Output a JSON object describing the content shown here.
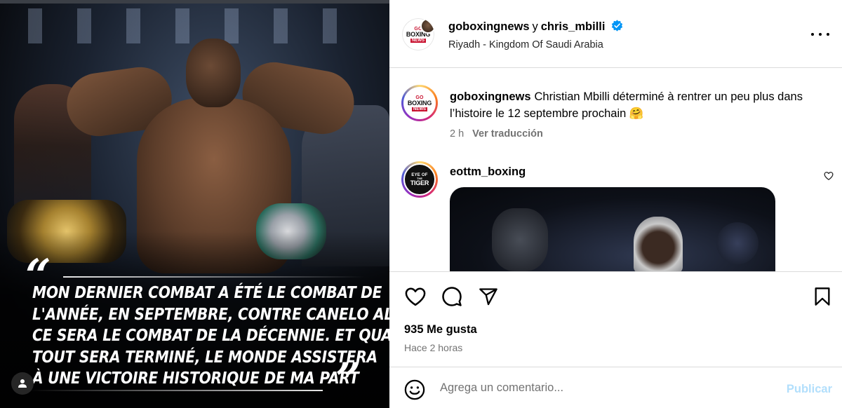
{
  "post_image": {
    "quote_open_mark": "“",
    "quote_close_mark": "”",
    "quote_lines": [
      "Mon dernier combat a été le combat de",
      "l'année, en septembre, contre Canelo Alvarez,",
      "ce sera le combat de la décennie. Et quand",
      "tout sera terminé, le monde assistera",
      "à une victoire historique de ma part"
    ],
    "tag_people_icon": "user-icon"
  },
  "header": {
    "user1": "goboxingnews",
    "separator": "y",
    "user2": "chris_mbilli",
    "verified_icon": "verified-badge-icon",
    "location": "Riyadh - Kingdom Of Saudi Arabia",
    "more_icon": "more-dots-icon",
    "logo": {
      "line1": "GO",
      "line2": "BOXING",
      "line3": "NEWS"
    }
  },
  "caption": {
    "username": "goboxingnews",
    "text": "Christian Mbilli déterminé à rentrer un peu plus dans l’histoire le 12 septembre prochain 🤗",
    "time": "2 h",
    "translate": "Ver traducción"
  },
  "comment": {
    "username": "eottm_boxing",
    "logo": {
      "line1": "EYE OF",
      "line2": "THE",
      "line3": "TIGER"
    },
    "like_icon": "heart-outline-icon"
  },
  "actions": {
    "like_icon": "heart-icon",
    "comment_icon": "comment-icon",
    "share_icon": "share-icon",
    "save_icon": "bookmark-icon",
    "likes": "935 Me gusta",
    "time_ago": "Hace 2 horas"
  },
  "add_comment": {
    "emoji_icon": "emoji-icon",
    "placeholder": "Agrega un comentario...",
    "publish_label": "Publicar",
    "publish_color": "#b2dffc"
  },
  "colors": {
    "text": "#000000",
    "secondary_text": "#737373",
    "border": "#dbdbdb",
    "verified_blue": "#0095f6"
  }
}
